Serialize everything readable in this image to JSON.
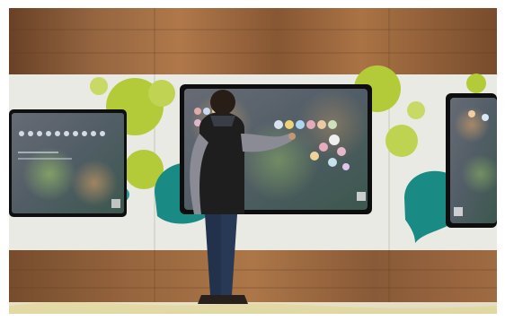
{
  "image": {
    "alt": "",
    "colors": {
      "wood_light": "#b47a4a",
      "wood_dark": "#7d4f2b",
      "panel": "#f2f2ec",
      "teal": "#1b8f8a",
      "lime": "#b9d23a",
      "screen_bezel": "#101010"
    }
  }
}
